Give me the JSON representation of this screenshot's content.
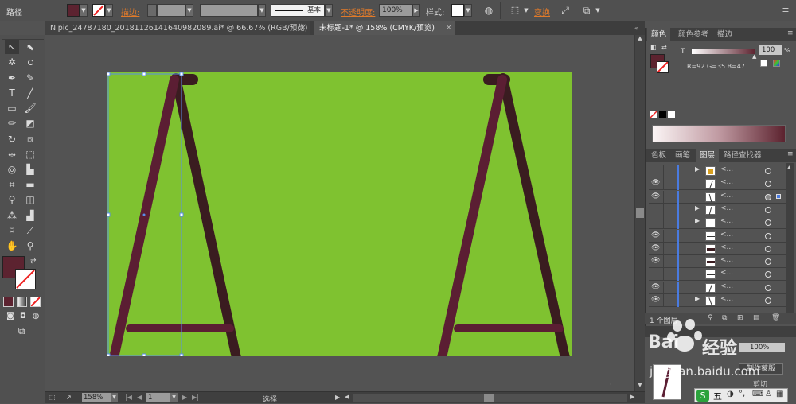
{
  "control_bar": {
    "path_label": "路径",
    "stroke_label": "描边:",
    "basic_label": "基本",
    "opacity_label": "不透明度:",
    "opacity_value": "100%",
    "style_label": "样式:",
    "transform_label": "变换",
    "fill_color": "#5c2330"
  },
  "tabs": [
    {
      "label": "Nipic_24787180_20181126141640982089.ai* @ 66.67% (RGB/预览)",
      "close": "×"
    },
    {
      "label": "未标题-1* @ 158% (CMYK/预览)",
      "close": "×"
    }
  ],
  "status": {
    "zoom": "158%",
    "page": "1",
    "tool_status": "选择"
  },
  "color_panel": {
    "tabs": [
      "颜色",
      "颜色参考",
      "描边"
    ],
    "tint_label": "T",
    "tint_value": "100",
    "percent": "%",
    "rgb_readout": "R=92 G=35 B=47",
    "color": "#5c232f"
  },
  "layers_panel": {
    "tabs": [
      "色板",
      "画笔",
      "图层",
      "路径查找器"
    ],
    "rows": [
      {
        "visible": false,
        "expand": true,
        "name": "<...",
        "selected": false
      },
      {
        "visible": true,
        "expand": false,
        "name": "<...",
        "selected": false
      },
      {
        "visible": true,
        "expand": false,
        "name": "<...",
        "selected": true
      },
      {
        "visible": false,
        "expand": true,
        "name": "<...",
        "selected": false
      },
      {
        "visible": false,
        "expand": true,
        "name": "<...",
        "selected": false
      },
      {
        "visible": true,
        "expand": false,
        "name": "<...",
        "selected": false
      },
      {
        "visible": true,
        "expand": false,
        "name": "<...",
        "selected": false
      },
      {
        "visible": true,
        "expand": false,
        "name": "<...",
        "selected": false
      },
      {
        "visible": false,
        "expand": false,
        "name": "<...",
        "selected": false
      },
      {
        "visible": true,
        "expand": false,
        "name": "<...",
        "selected": false
      },
      {
        "visible": true,
        "expand": true,
        "name": "<...",
        "selected": false
      }
    ],
    "footer_count": "1 个图层"
  },
  "transparency_panel": {
    "percent": "100%",
    "make_mask": "制作蒙版",
    "clip": "剪切"
  },
  "watermark": {
    "brand": "Bai",
    "brand2": "经验",
    "url": "jingyan.baidu.com"
  },
  "ime": {
    "label": "五"
  },
  "artwork": {
    "artboard_color": "#7fc230",
    "leg_light": "#5b1e33",
    "leg_dark": "#3a1c20"
  }
}
